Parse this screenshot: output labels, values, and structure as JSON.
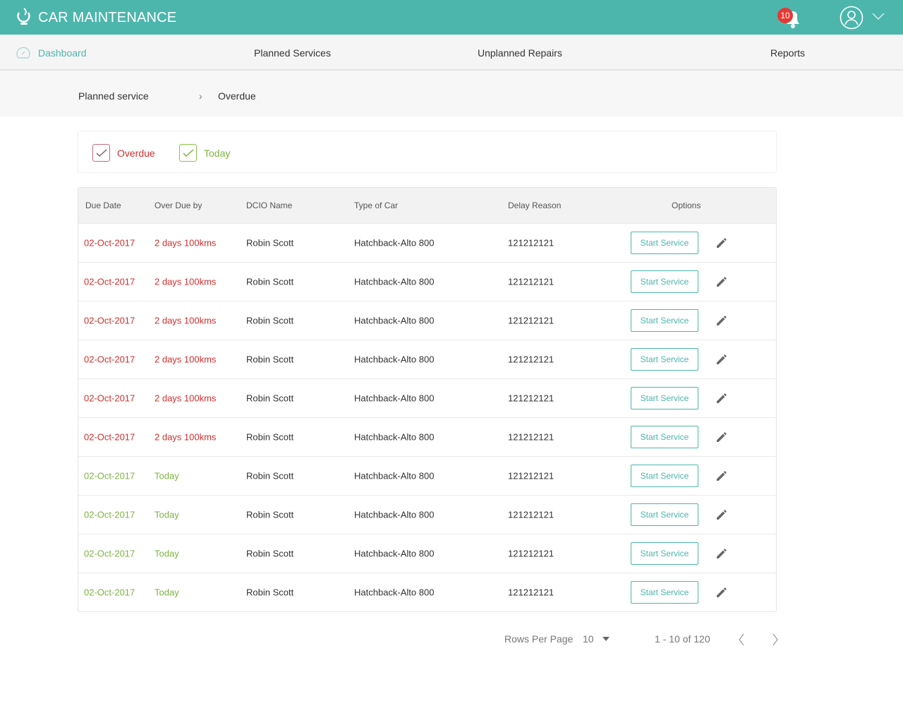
{
  "app": {
    "title": "CAR MAINTENANCE",
    "notification_count": "10",
    "accent": "#4db6ac"
  },
  "nav": {
    "items": [
      {
        "label": "Dashboard",
        "active": true
      },
      {
        "label": "Planned Services"
      },
      {
        "label": "Unplanned Repairs"
      },
      {
        "label": "Reports"
      }
    ]
  },
  "breadcrumb": {
    "parent": "Planned service",
    "current": "Overdue"
  },
  "filters": {
    "overdue": {
      "label": "Overdue",
      "checked": true,
      "color": "#d32f2f"
    },
    "today": {
      "label": "Today",
      "checked": true,
      "color": "#7cb342"
    }
  },
  "table": {
    "columns": [
      "Due Date",
      "Over Due by",
      "DCIO Name",
      "Type of Car",
      "Delay Reason",
      "Options"
    ],
    "action_label": "Start Service",
    "rows": [
      {
        "status": "overdue",
        "due": "02-Oct-2017",
        "by": "2 days 100kms",
        "name": "Robin Scott",
        "car": "Hatchback-Alto 800",
        "reason": "121212121"
      },
      {
        "status": "overdue",
        "due": "02-Oct-2017",
        "by": "2 days 100kms",
        "name": "Robin Scott",
        "car": "Hatchback-Alto 800",
        "reason": "121212121"
      },
      {
        "status": "overdue",
        "due": "02-Oct-2017",
        "by": "2 days 100kms",
        "name": "Robin Scott",
        "car": "Hatchback-Alto 800",
        "reason": "121212121"
      },
      {
        "status": "overdue",
        "due": "02-Oct-2017",
        "by": "2 days 100kms",
        "name": "Robin Scott",
        "car": "Hatchback-Alto 800",
        "reason": "121212121"
      },
      {
        "status": "overdue",
        "due": "02-Oct-2017",
        "by": "2 days 100kms",
        "name": "Robin Scott",
        "car": "Hatchback-Alto 800",
        "reason": "121212121"
      },
      {
        "status": "overdue",
        "due": "02-Oct-2017",
        "by": "2 days 100kms",
        "name": "Robin Scott",
        "car": "Hatchback-Alto 800",
        "reason": "121212121"
      },
      {
        "status": "today",
        "due": "02-Oct-2017",
        "by": "Today",
        "name": "Robin Scott",
        "car": "Hatchback-Alto 800",
        "reason": "121212121"
      },
      {
        "status": "today",
        "due": "02-Oct-2017",
        "by": "Today",
        "name": "Robin Scott",
        "car": "Hatchback-Alto 800",
        "reason": "121212121"
      },
      {
        "status": "today",
        "due": "02-Oct-2017",
        "by": "Today",
        "name": "Robin Scott",
        "car": "Hatchback-Alto 800",
        "reason": "121212121"
      },
      {
        "status": "today",
        "due": "02-Oct-2017",
        "by": "Today",
        "name": "Robin Scott",
        "car": "Hatchback-Alto 800",
        "reason": "121212121"
      }
    ]
  },
  "pagination": {
    "rows_per_page_label": "Rows Per Page",
    "rows_per_page": "10",
    "range": "1 - 10 of 120"
  }
}
